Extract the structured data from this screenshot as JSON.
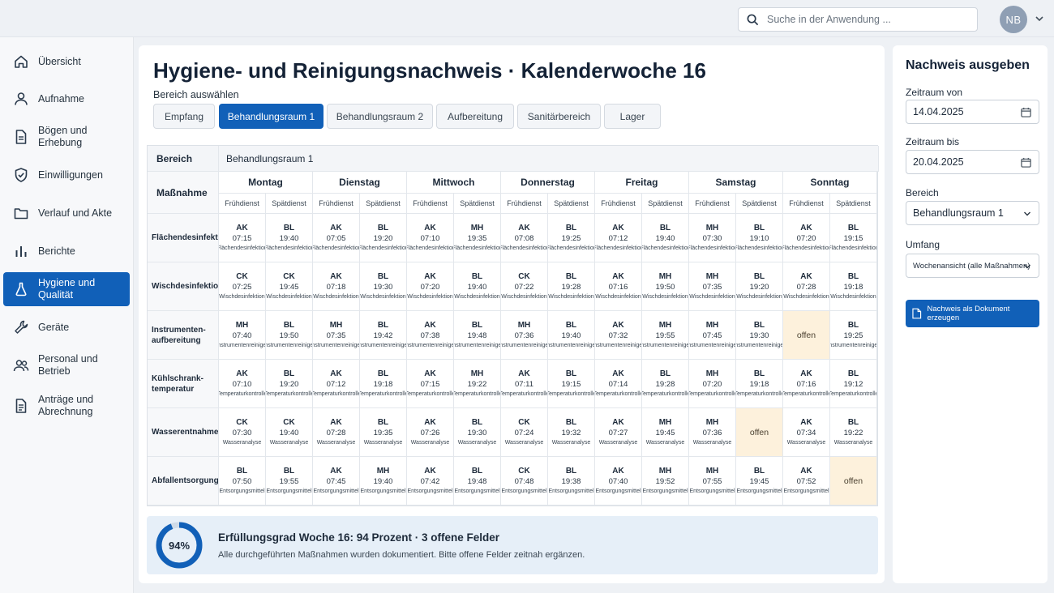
{
  "header": {
    "search_placeholder": "Suche in der Anwendung ...",
    "avatar_initials": "NB"
  },
  "sidebar": {
    "items": [
      {
        "label": "Übersicht",
        "icon": "home-icon"
      },
      {
        "label": "Aufnahme",
        "icon": "person-icon"
      },
      {
        "label": "Bögen und Erhebung",
        "icon": "document-icon"
      },
      {
        "label": "Einwilligungen",
        "icon": "shield-icon"
      },
      {
        "label": "Verlauf und Akte",
        "icon": "folder-icon"
      },
      {
        "label": "Berichte",
        "icon": "bar-chart-icon"
      },
      {
        "label": "Hygiene und Qualität",
        "icon": "flask-icon",
        "active": true
      },
      {
        "label": "Geräte",
        "icon": "wrench-icon"
      },
      {
        "label": "Personal und Betrieb",
        "icon": "people-icon"
      },
      {
        "label": "Anträge und Abrechnung",
        "icon": "file-icon"
      }
    ]
  },
  "main": {
    "title": "Hygiene- und Reinigungsnachweis · Kalenderwoche 16",
    "area_label": "Bereich auswählen",
    "tabs": [
      "Empfang",
      "Behandlungsraum 1",
      "Behandlungsraum 2",
      "Aufbereitung",
      "Sanitärbereich",
      "Lager"
    ],
    "active_tab": 1,
    "table": {
      "area_header": "Bereich",
      "area_value": "Behandlungsraum 1",
      "measure_header": "Maßnahme",
      "days": [
        "Montag",
        "Dienstag",
        "Mittwoch",
        "Donnerstag",
        "Freitag",
        "Samstag",
        "Sonntag"
      ],
      "shifts": [
        "Frühdienst",
        "Spätdienst"
      ],
      "open_label": "offen",
      "rows": [
        {
          "name": "Flächendesinfektion",
          "method": "Flächendesinfektion",
          "entries": [
            [
              "AK",
              "07:15"
            ],
            [
              "BL",
              "19:40"
            ],
            [
              "AK",
              "07:05"
            ],
            [
              "BL",
              "19:20"
            ],
            [
              "AK",
              "07:10"
            ],
            [
              "MH",
              "19:35"
            ],
            [
              "AK",
              "07:08"
            ],
            [
              "BL",
              "19:25"
            ],
            [
              "AK",
              "07:12"
            ],
            [
              "BL",
              "19:40"
            ],
            [
              "MH",
              "07:30"
            ],
            [
              "BL",
              "19:10"
            ],
            [
              "AK",
              "07:20"
            ],
            [
              "BL",
              "19:15"
            ]
          ]
        },
        {
          "name": "Wischdesinfektion",
          "method": "Wischdesinfektion",
          "entries": [
            [
              "CK",
              "07:25"
            ],
            [
              "CK",
              "19:45"
            ],
            [
              "AK",
              "07:18"
            ],
            [
              "BL",
              "19:30"
            ],
            [
              "AK",
              "07:20"
            ],
            [
              "BL",
              "19:40"
            ],
            [
              "CK",
              "07:22"
            ],
            [
              "BL",
              "19:28"
            ],
            [
              "AK",
              "07:16"
            ],
            [
              "MH",
              "19:50"
            ],
            [
              "MH",
              "07:35"
            ],
            [
              "BL",
              "19:20"
            ],
            [
              "AK",
              "07:28"
            ],
            [
              "BL",
              "19:18"
            ]
          ]
        },
        {
          "name": "Instrumenten-aufbereitung",
          "method": "Instrumentenreiniger",
          "entries": [
            [
              "MH",
              "07:40"
            ],
            [
              "BL",
              "19:50"
            ],
            [
              "MH",
              "07:35"
            ],
            [
              "BL",
              "19:42"
            ],
            [
              "AK",
              "07:38"
            ],
            [
              "BL",
              "19:48"
            ],
            [
              "MH",
              "07:36"
            ],
            [
              "BL",
              "19:40"
            ],
            [
              "AK",
              "07:32"
            ],
            [
              "MH",
              "19:55"
            ],
            [
              "MH",
              "07:45"
            ],
            [
              "BL",
              "19:30"
            ],
            null,
            [
              "BL",
              "19:25"
            ]
          ]
        },
        {
          "name": "Kühlschrank-temperatur",
          "method": "Temperaturkontrolle",
          "entries": [
            [
              "AK",
              "07:10"
            ],
            [
              "BL",
              "19:20"
            ],
            [
              "AK",
              "07:12"
            ],
            [
              "BL",
              "19:18"
            ],
            [
              "AK",
              "07:15"
            ],
            [
              "MH",
              "19:22"
            ],
            [
              "AK",
              "07:11"
            ],
            [
              "BL",
              "19:15"
            ],
            [
              "AK",
              "07:14"
            ],
            [
              "BL",
              "19:28"
            ],
            [
              "MH",
              "07:20"
            ],
            [
              "BL",
              "19:18"
            ],
            [
              "AK",
              "07:16"
            ],
            [
              "BL",
              "19:12"
            ]
          ]
        },
        {
          "name": "Wasserentnahme",
          "method": "Wasseranalyse",
          "entries": [
            [
              "CK",
              "07:30"
            ],
            [
              "CK",
              "19:40"
            ],
            [
              "AK",
              "07:28"
            ],
            [
              "BL",
              "19:35"
            ],
            [
              "AK",
              "07:26"
            ],
            [
              "BL",
              "19:30"
            ],
            [
              "CK",
              "07:24"
            ],
            [
              "BL",
              "19:32"
            ],
            [
              "AK",
              "07:27"
            ],
            [
              "MH",
              "19:45"
            ],
            [
              "MH",
              "07:36"
            ],
            null,
            [
              "AK",
              "07:34"
            ],
            [
              "BL",
              "19:22"
            ]
          ]
        },
        {
          "name": "Abfallentsorgung",
          "method": "Entsorgungsmittel",
          "entries": [
            [
              "BL",
              "07:50"
            ],
            [
              "BL",
              "19:55"
            ],
            [
              "AK",
              "07:45"
            ],
            [
              "MH",
              "19:40"
            ],
            [
              "AK",
              "07:42"
            ],
            [
              "BL",
              "19:48"
            ],
            [
              "CK",
              "07:48"
            ],
            [
              "BL",
              "19:38"
            ],
            [
              "AK",
              "07:40"
            ],
            [
              "MH",
              "19:52"
            ],
            [
              "MH",
              "07:55"
            ],
            [
              "BL",
              "19:45"
            ],
            [
              "AK",
              "07:52"
            ],
            null
          ]
        }
      ]
    },
    "summary": {
      "percent": 94,
      "percent_label": "94%",
      "headline": "Erfüllungsgrad Woche 16: 94 Prozent  ·  3 offene Felder",
      "text": "Alle durchgeführten Maßnahmen wurden dokumentiert. Bitte offene Felder zeitnah ergänzen."
    }
  },
  "export": {
    "title": "Nachweis ausgeben",
    "from_label": "Zeitraum von",
    "from_value": "14.04.2025",
    "to_label": "Zeitraum bis",
    "to_value": "20.04.2025",
    "area_label": "Bereich",
    "area_value": "Behandlungsraum 1",
    "scope_label": "Umfang",
    "scope_value": "Wochenansicht (alle Maßnahmen)",
    "button_label": "Nachweis als Dokument erzeugen"
  },
  "colors": {
    "primary": "#1160b8",
    "open_cell": "#fdf1dc",
    "summary_bg": "#e6eff8"
  }
}
